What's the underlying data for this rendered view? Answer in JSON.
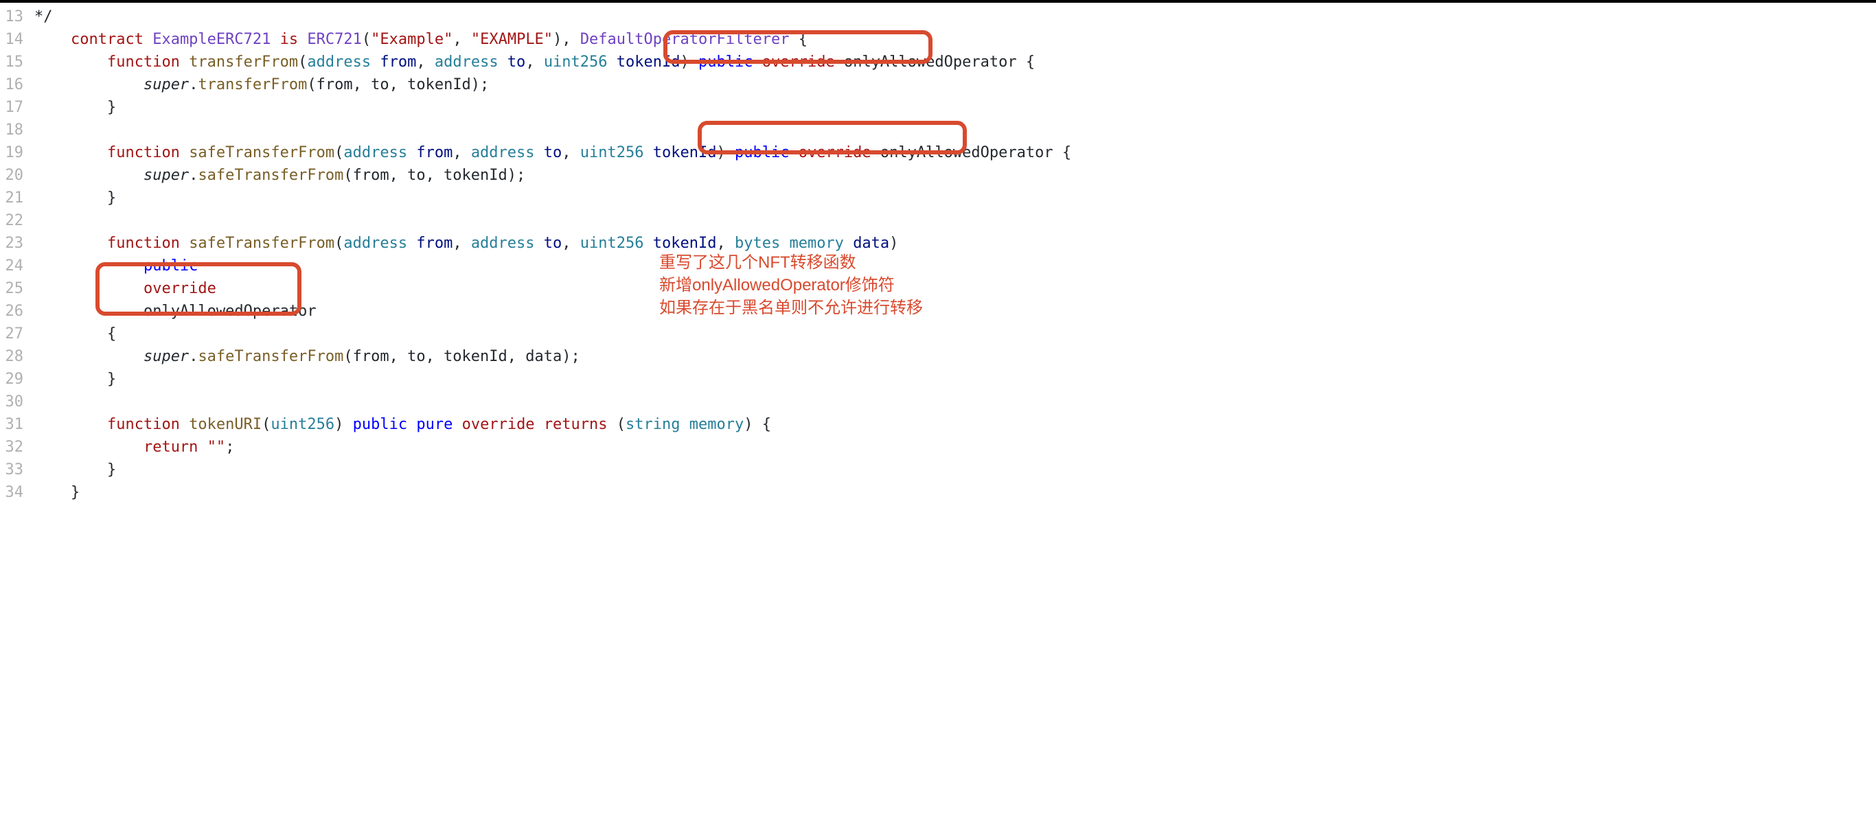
{
  "lines": {
    "l13": {
      "num": "13",
      "t_punc": "*/"
    },
    "l14": {
      "num": "14",
      "kw_contract": "contract",
      "cls_name": "ExampleERC721",
      "kw_is": "is",
      "cls_erc": "ERC721",
      "str_a": "\"Example\"",
      "str_b": "\"EXAMPLE\"",
      "cls_filter": "DefaultOperatorFilterer",
      "brace": "{"
    },
    "l15": {
      "num": "15",
      "kw_fn": "function",
      "fn_name": "transferFrom",
      "t_addr1": "address",
      "p_from": "from",
      "t_addr2": "address",
      "p_to": "to",
      "t_uint": "uint256",
      "p_token": "tokenId",
      "vis": "public",
      "ovr": "override",
      "mod": "onlyAllowedOperator",
      "brace": "{"
    },
    "l16": {
      "num": "16",
      "sup": "super",
      "fn": "transferFrom",
      "args": "(from, to, tokenId);"
    },
    "l17": {
      "num": "17",
      "brace": "}"
    },
    "l18": {
      "num": "18"
    },
    "l19": {
      "num": "19",
      "kw_fn": "function",
      "fn_name": "safeTransferFrom",
      "t_addr1": "address",
      "p_from": "from",
      "t_addr2": "address",
      "p_to": "to",
      "t_uint": "uint256",
      "p_token": "tokenId",
      "vis": "public",
      "ovr": "override",
      "mod": "onlyAllowedOperator",
      "brace": "{"
    },
    "l20": {
      "num": "20",
      "sup": "super",
      "fn": "safeTransferFrom",
      "args": "(from, to, tokenId);"
    },
    "l21": {
      "num": "21",
      "brace": "}"
    },
    "l22": {
      "num": "22"
    },
    "l23": {
      "num": "23",
      "kw_fn": "function",
      "fn_name": "safeTransferFrom",
      "t_addr1": "address",
      "p_from": "from",
      "t_addr2": "address",
      "p_to": "to",
      "t_uint": "uint256",
      "p_token": "tokenId",
      "t_bytes": "bytes",
      "t_memory": "memory",
      "p_data": "data",
      "paren_close": ")"
    },
    "l24": {
      "num": "24",
      "vis": "public"
    },
    "l25": {
      "num": "25",
      "ovr": "override"
    },
    "l26": {
      "num": "26",
      "mod": "onlyAllowedOperator"
    },
    "l27": {
      "num": "27",
      "brace": "{"
    },
    "l28": {
      "num": "28",
      "sup": "super",
      "fn": "safeTransferFrom",
      "args": "(from, to, tokenId, data);"
    },
    "l29": {
      "num": "29",
      "brace": "}"
    },
    "l30": {
      "num": "30"
    },
    "l31": {
      "num": "31",
      "kw_fn": "function",
      "fn_name": "tokenURI",
      "t_uint": "uint256",
      "vis": "public",
      "kw_pure": "pure",
      "ovr": "override",
      "kw_returns": "returns",
      "t_string": "string",
      "t_memory": "memory",
      "brace": "{"
    },
    "l32": {
      "num": "32",
      "kw_return": "return",
      "str_empty": "\"\"",
      "semi": ";"
    },
    "l33": {
      "num": "33",
      "brace": "}"
    },
    "l34": {
      "num": "34",
      "brace": "}"
    }
  },
  "annotations": {
    "a1": "重写了这几个NFT转移函数",
    "a2": "新增onlyAllowedOperator修饰符",
    "a3": "如果存在于黑名单则不允许进行转移"
  },
  "colors": {
    "highlight_border": "#d84a2e"
  }
}
